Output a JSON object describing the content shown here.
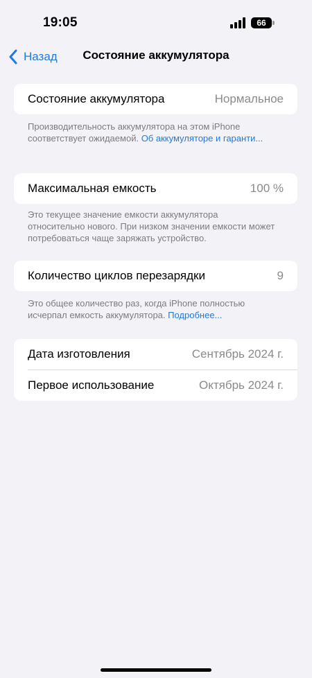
{
  "status_bar": {
    "time": "19:05",
    "battery_level": "66",
    "signal_icon": "cellular-signal-icon",
    "battery_icon": "battery-icon"
  },
  "nav": {
    "back_label": "Назад",
    "title": "Состояние аккумулятора"
  },
  "battery_health": {
    "label": "Состояние аккумулятора",
    "value": "Нормальное",
    "note_text": "Производительность аккумулятора на этом iPhone соответствует ожидаемой. ",
    "note_link": "Об аккумуляторе и гаранти..."
  },
  "max_capacity": {
    "label": "Максимальная емкость",
    "value": "100 %",
    "note_text": "Это текущее значение емкости аккумулятора относительно нового. При низком значении емкости может потребоваться чаще заряжать устройство."
  },
  "cycle_count": {
    "label": "Количество циклов перезарядки",
    "value": "9",
    "note_text": "Это общее количество раз, когда iPhone полностью исчерпал емкость аккумулятора. ",
    "note_link": "Подробнее..."
  },
  "dates": {
    "manufacture_label": "Дата изготовления",
    "manufacture_value": "Сентябрь 2024 г.",
    "first_use_label": "Первое использование",
    "first_use_value": "Октябрь 2024 г."
  },
  "colors": {
    "accent": "#1f7ae0",
    "background": "#f2f2f7",
    "secondary_text": "#8a8a8e"
  }
}
